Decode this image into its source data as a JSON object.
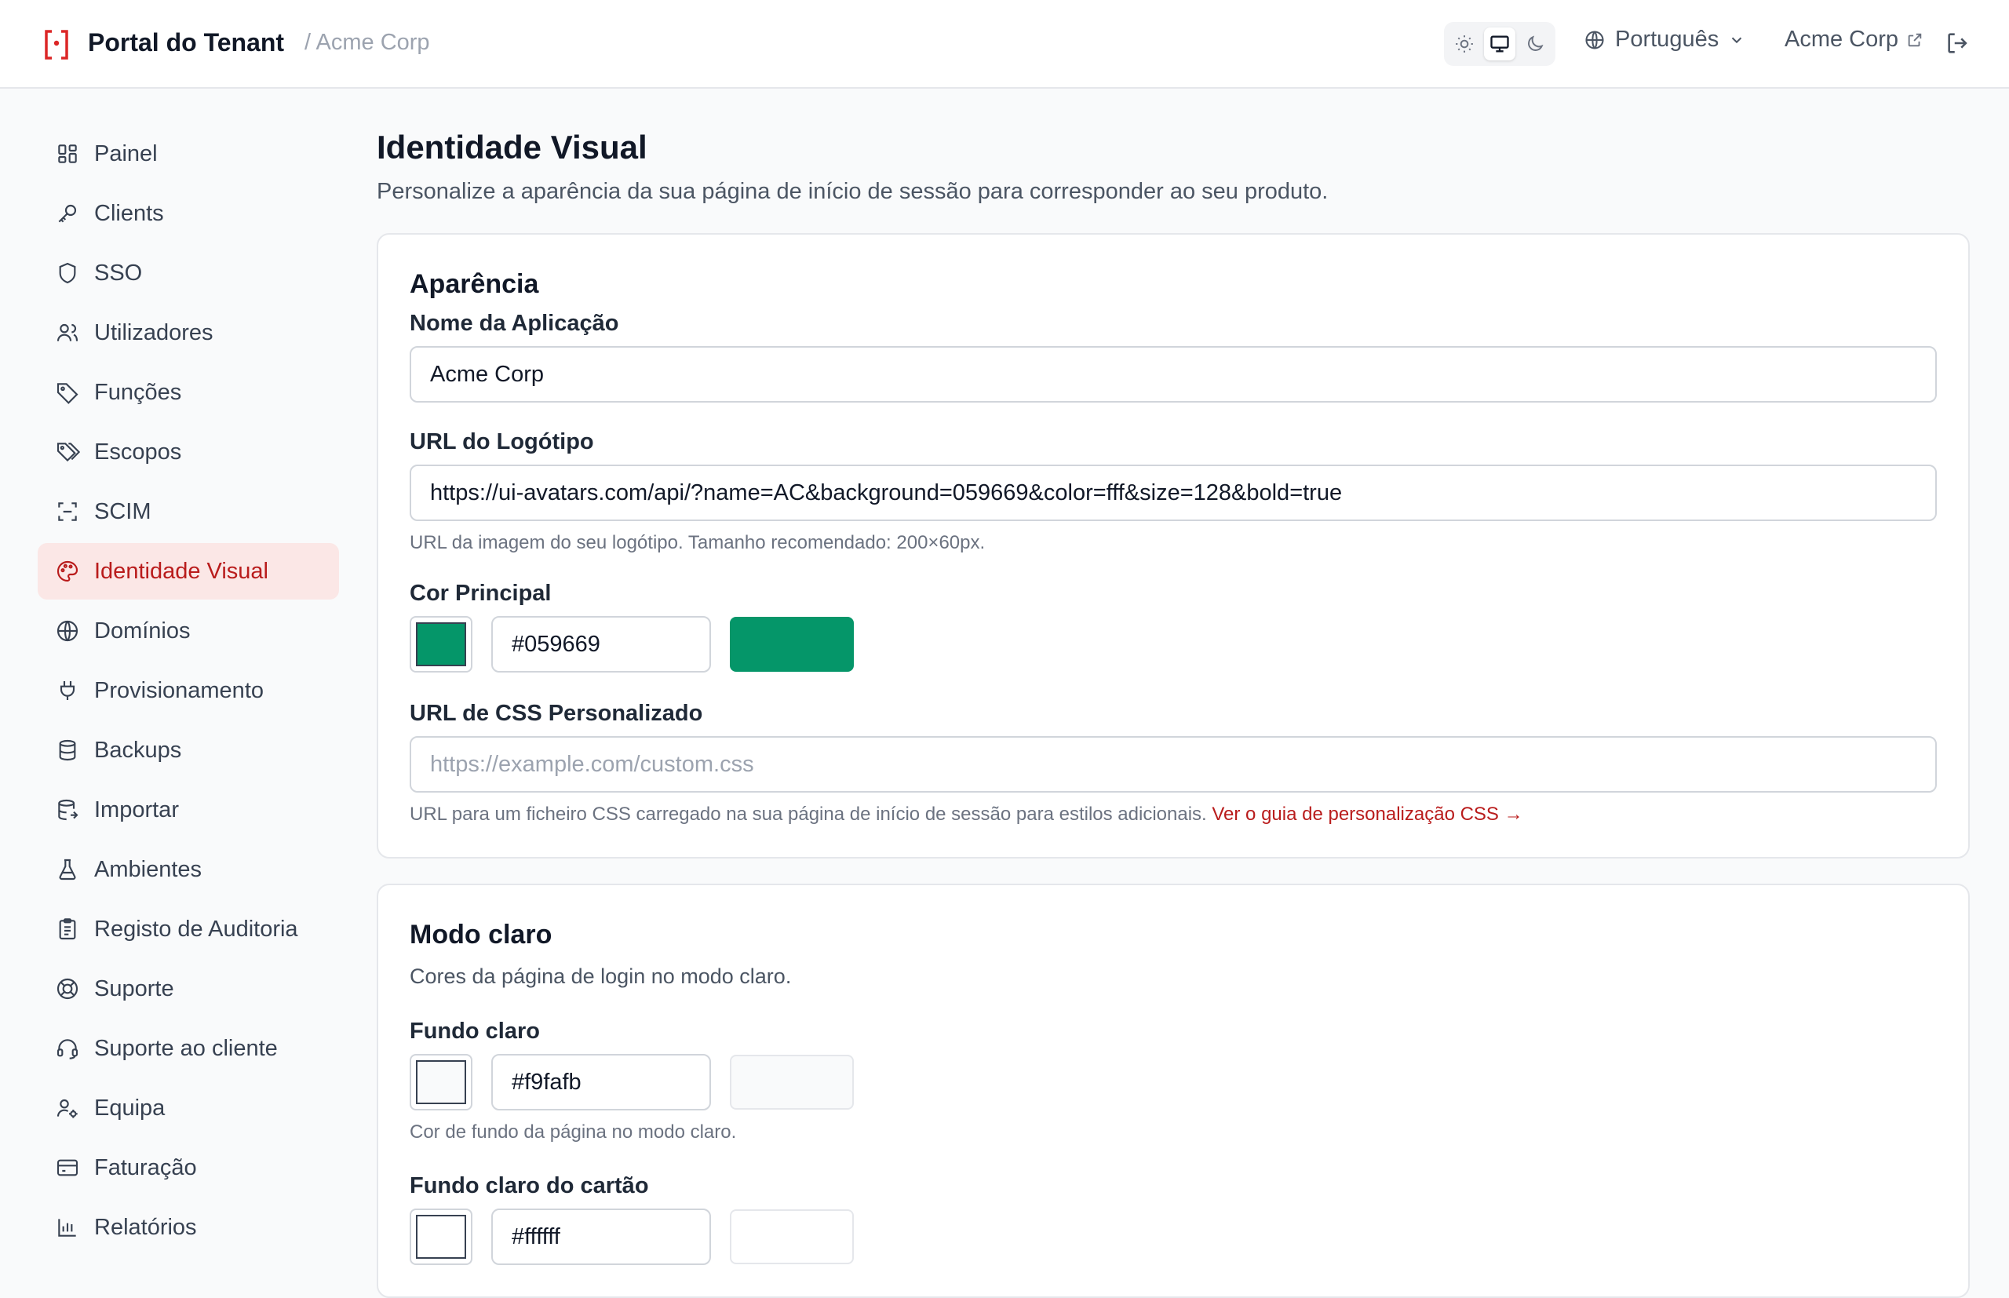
{
  "header": {
    "title": "Portal do Tenant",
    "breadcrumb": "/ Acme Corp",
    "theme": {
      "options": [
        "sun-icon",
        "monitor-icon",
        "moon-icon"
      ],
      "selected": "monitor-icon"
    },
    "language": "Português",
    "tenant_link": "Acme Corp",
    "brand_color": "#dc2626"
  },
  "sidebar": {
    "items": [
      {
        "label": "Painel",
        "icon": "dashboard-icon"
      },
      {
        "label": "Clients",
        "icon": "key-icon"
      },
      {
        "label": "SSO",
        "icon": "shield-icon"
      },
      {
        "label": "Utilizadores",
        "icon": "users-icon"
      },
      {
        "label": "Funções",
        "icon": "tag-icon"
      },
      {
        "label": "Escopos",
        "icon": "tags-icon"
      },
      {
        "label": "SCIM",
        "icon": "scan-icon"
      },
      {
        "label": "Identidade Visual",
        "icon": "palette-icon",
        "active": true
      },
      {
        "label": "Domínios",
        "icon": "globe-icon"
      },
      {
        "label": "Provisionamento",
        "icon": "plug-icon"
      },
      {
        "label": "Backups",
        "icon": "database-icon"
      },
      {
        "label": "Importar",
        "icon": "database-import-icon"
      },
      {
        "label": "Ambientes",
        "icon": "flask-icon"
      },
      {
        "label": "Registo de Auditoria",
        "icon": "clipboard-icon"
      },
      {
        "label": "Suporte",
        "icon": "lifebuoy-icon"
      },
      {
        "label": "Suporte ao cliente",
        "icon": "headset-icon"
      },
      {
        "label": "Equipa",
        "icon": "user-cog-icon"
      },
      {
        "label": "Faturação",
        "icon": "credit-card-icon"
      },
      {
        "label": "Relatórios",
        "icon": "bar-chart-icon"
      }
    ]
  },
  "main": {
    "title": "Identidade Visual",
    "subtitle": "Personalize a aparência da sua página de início de sessão para corresponder ao seu produto.",
    "appearance": {
      "title": "Aparência",
      "app_name_label": "Nome da Aplicação",
      "app_name_value": "Acme Corp",
      "logo_url_label": "URL do Logótipo",
      "logo_url_value": "https://ui-avatars.com/api/?name=AC&background=059669&color=fff&size=128&bold=true",
      "logo_url_help": "URL da imagem do seu logótipo. Tamanho recomendado: 200×60px.",
      "primary_color_label": "Cor Principal",
      "primary_color_value": "#059669",
      "css_url_label": "URL de CSS Personalizado",
      "css_url_placeholder": "https://example.com/custom.css",
      "css_url_help": "URL para um ficheiro CSS carregado na sua página de início de sessão para estilos adicionais.",
      "css_guide_link": "Ver o guia de personalização CSS →"
    },
    "light_mode": {
      "title": "Modo claro",
      "description": "Cores da página de login no modo claro.",
      "bg_label": "Fundo claro",
      "bg_value": "#f9fafb",
      "bg_help": "Cor de fundo da página no modo claro.",
      "card_bg_label": "Fundo claro do cartão",
      "card_bg_value": "#ffffff"
    }
  }
}
